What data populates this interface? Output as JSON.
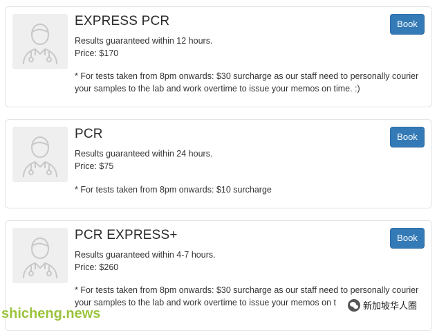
{
  "tests": [
    {
      "title": "EXPRESS PCR",
      "results": "Results guaranteed within 12 hours.",
      "price": "Price: $170",
      "note_line1": "* For tests taken from 8pm onwards: $30 surcharge as our staff need to personally courier",
      "note_line2": "your samples to the lab and work overtime to issue your memos on time. :)",
      "book_label": "Book",
      "avatar_icon": "doctor-avatar-icon"
    },
    {
      "title": "PCR",
      "results": "Results guaranteed within 24 hours.",
      "price": "Price: $75",
      "note_line1": "* For tests taken from 8pm onwards: $10 surcharge",
      "book_label": "Book",
      "avatar_icon": "doctor-avatar-icon"
    },
    {
      "title": "PCR EXPRESS+",
      "results": "Results guaranteed within 4-7 hours.",
      "price": "Price: $260",
      "note_line1": "* For tests taken from 8pm onwards: $30 surcharge as our staff need to personally courier",
      "note_line2": "your samples to the lab and work overtime to issue your memos on t",
      "book_label": "Book",
      "avatar_icon": "doctor-avatar-icon"
    }
  ],
  "watermark": {
    "text": "shicheng.news",
    "color": "#9ac33c"
  },
  "wechat_badge": {
    "text": "新加坡华人圈",
    "icon": "wechat-icon"
  },
  "colors": {
    "book_button": "#337ab7",
    "card_border": "#e4e4e4"
  }
}
